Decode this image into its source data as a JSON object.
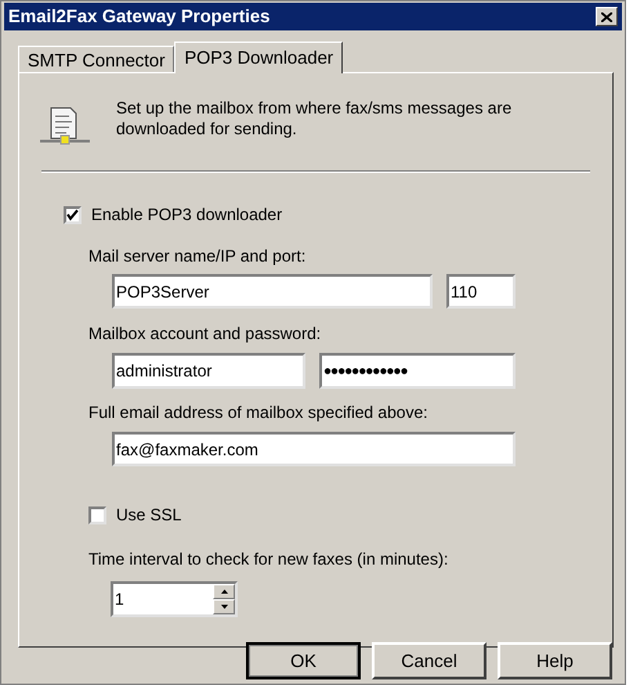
{
  "window": {
    "title": "Email2Fax Gateway Properties"
  },
  "tabs": [
    {
      "label": "SMTP Connector",
      "selected": false
    },
    {
      "label": "POP3 Downloader",
      "selected": true
    }
  ],
  "description": "Set up the mailbox from where fax/sms messages are downloaded for sending.",
  "enable_pop3": {
    "label": "Enable POP3 downloader",
    "checked": true
  },
  "server": {
    "label": "Mail server name/IP and port:",
    "name": "POP3Server",
    "port": "110"
  },
  "account": {
    "label": "Mailbox account and password:",
    "user": "administrator",
    "password": "●●●●●●●●●●●●"
  },
  "email": {
    "label": "Full email address of mailbox specified above:",
    "value": "fax@faxmaker.com"
  },
  "use_ssl": {
    "label": "Use SSL",
    "checked": false
  },
  "interval": {
    "label": "Time interval to check for new faxes (in minutes):",
    "value": "1"
  },
  "buttons": [
    {
      "label": "OK",
      "default": true
    },
    {
      "label": "Cancel",
      "default": false
    },
    {
      "label": "Help",
      "default": false
    }
  ]
}
